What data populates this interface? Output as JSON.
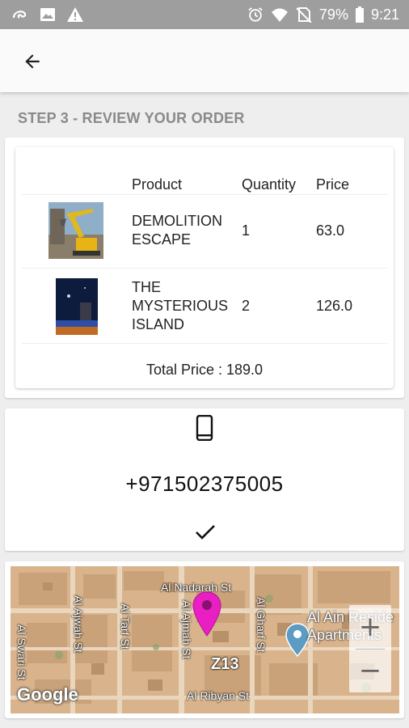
{
  "status_bar": {
    "battery": "79%",
    "time": "9:21",
    "icons": [
      "app-icon",
      "image-icon",
      "warning-icon",
      "alarm-icon",
      "wifi-icon",
      "no-sim-icon",
      "battery-icon"
    ]
  },
  "app_bar": {
    "back_icon": "arrow-back-icon"
  },
  "step_title": "STEP 3 - REVIEW YOUR ORDER",
  "order": {
    "headers": {
      "product": "Product",
      "quantity": "Quantity",
      "price": "Price"
    },
    "items": [
      {
        "name_line1": "DEMOLITION",
        "name_line2": "ESCAPE",
        "name_line3": "",
        "quantity": "1",
        "price": "63.0"
      },
      {
        "name_line1": "THE",
        "name_line2": "MYSTERIOUS",
        "name_line3": "ISLAND",
        "quantity": "2",
        "price": "126.0"
      }
    ],
    "total": "Total Price : 189.0"
  },
  "contact": {
    "icon": "smartphone-icon",
    "phone": "+971502375005",
    "confirm_icon": "check-icon"
  },
  "map": {
    "streets": {
      "nadarah": "Al Nadarah St",
      "ajwah": "Al Ajwah St",
      "tarf": "Al Tarf St",
      "ajmah": "Al Ajmah St",
      "gharf": "Al Gharf St",
      "ribyan": "Al Ribyan St",
      "wari": "Al Swari St"
    },
    "place": "Al Ain Resid­e\nApartments",
    "place_line1": "Al Ain Reside",
    "place_line2": "Apartments",
    "zone": "Z13",
    "attribution": "Google",
    "zoom_in": "+",
    "zoom_out": "−",
    "marker_color": "#e91ec3",
    "poi_color": "#5c9bc4"
  }
}
